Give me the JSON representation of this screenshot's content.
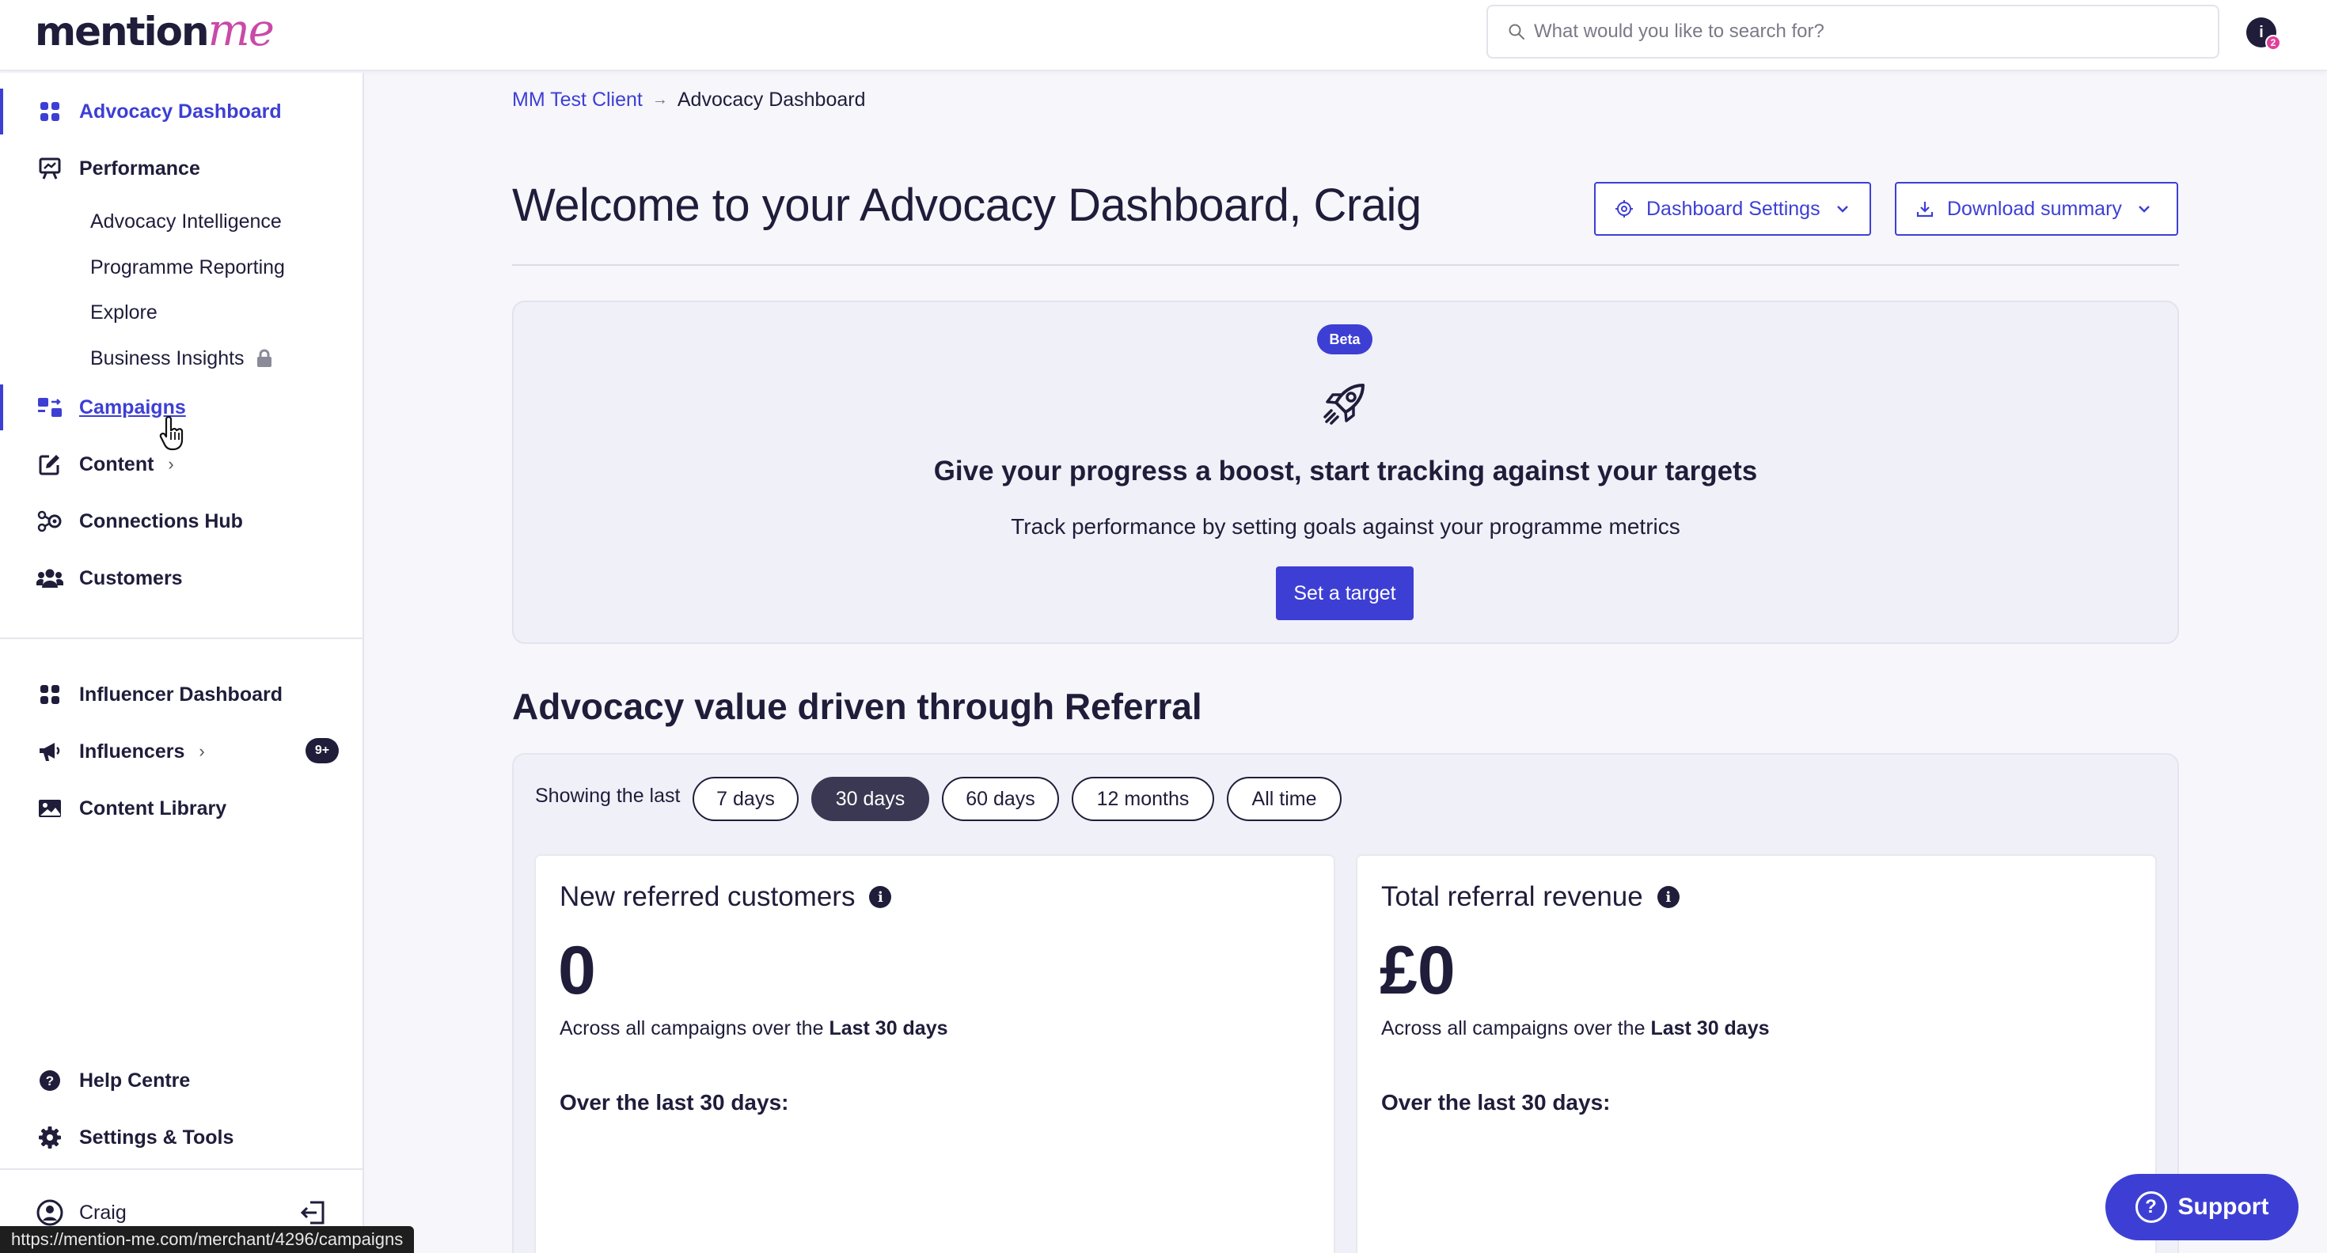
{
  "header": {
    "logo_part1": "mention",
    "logo_part2": "me",
    "search_placeholder": "What would you like to search for?",
    "user_initial": "i",
    "notification_count": "2"
  },
  "sidebar": {
    "advocacy_dashboard": "Advocacy Dashboard",
    "performance": "Performance",
    "performance_sub": [
      "Advocacy Intelligence",
      "Programme Reporting",
      "Explore",
      "Business Insights"
    ],
    "campaigns": "Campaigns",
    "content": "Content",
    "connections_hub": "Connections Hub",
    "customers": "Customers",
    "influencer_dashboard": "Influencer Dashboard",
    "influencers": "Influencers",
    "influencers_badge": "9+",
    "content_library": "Content Library",
    "help_centre": "Help Centre",
    "settings_tools": "Settings & Tools",
    "user_name": "Craig"
  },
  "status_bar": {
    "url": "https://mention-me.com/merchant/4296/campaigns"
  },
  "main": {
    "breadcrumb": {
      "client": "MM Test Client",
      "arrow": "→",
      "current": "Advocacy Dashboard"
    },
    "welcome_title": "Welcome to your Advocacy Dashboard, Craig",
    "dashboard_settings_label": "Dashboard Settings",
    "download_summary_label": "Download summary",
    "boost": {
      "badge": "Beta",
      "title": "Give your progress a boost, start tracking against your targets",
      "subtitle": "Track performance by setting goals against your programme metrics",
      "button": "Set a target"
    },
    "section_title": "Advocacy value driven through Referral",
    "filter": {
      "label": "Showing the last",
      "options": [
        "7 days",
        "30 days",
        "60 days",
        "12 months",
        "All time"
      ],
      "selected": "30 days"
    },
    "cards": [
      {
        "title": "New referred customers",
        "value": "0",
        "desc_prefix": "Across all campaigns over the",
        "desc_bold": "Last 30 days",
        "over_label": "Over the last 30 days:"
      },
      {
        "title": "Total referral revenue",
        "value": "£0",
        "desc_prefix": "Across all campaigns over the",
        "desc_bold": "Last 30 days",
        "over_label": "Over the last 30 days:"
      }
    ]
  },
  "support_label": "Support",
  "colors": {
    "accent": "#3d3fd4",
    "brand_pink": "#c94aa8",
    "text_dark": "#1f1d3a",
    "chip_selected": "#3a3852"
  }
}
